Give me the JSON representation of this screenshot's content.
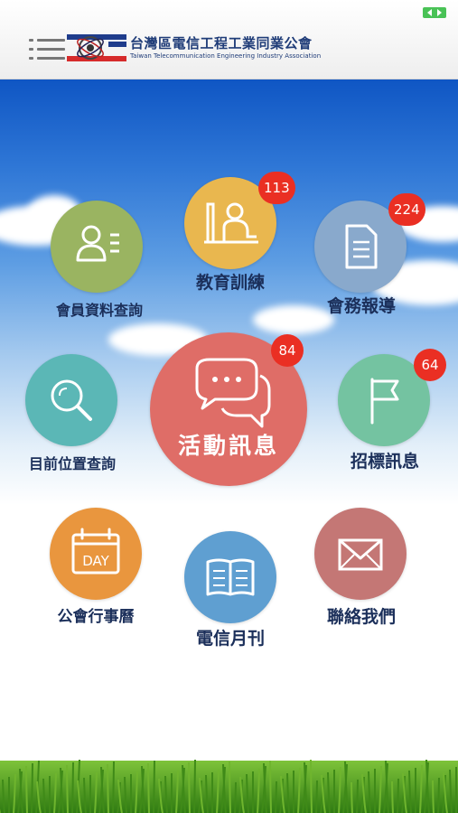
{
  "header": {
    "org_name": "台灣區電信工程工業同業公會",
    "org_name_en": "Taiwan Telecommunication Engineering Industry Association"
  },
  "icons": {
    "menu": "hamburger-menu-icon",
    "status": "battery-icon"
  },
  "colors": {
    "green": "#9ab461",
    "yellow": "#e9b74f",
    "blue_gray": "#89a9cc",
    "teal": "#5bb7b6",
    "red": "#df6d67",
    "mint": "#74c3a1",
    "orange": "#e9963e",
    "blue": "#5f9fd1",
    "rose": "#c47775",
    "badge": "#ea2f23"
  },
  "menu": {
    "member": {
      "label": "會員資料查詢"
    },
    "education": {
      "label": "教育訓練",
      "badge": "113"
    },
    "affairs": {
      "label": "會務報導",
      "badge": "224"
    },
    "location": {
      "label": "目前位置查詢"
    },
    "activity": {
      "label": "活動訊息",
      "badge": "84"
    },
    "tender": {
      "label": "招標訊息",
      "badge": "64"
    },
    "calendar": {
      "label": "公會行事曆",
      "icon_text": "DAY"
    },
    "monthly": {
      "label": "電信月刊"
    },
    "contact": {
      "label": "聯絡我們"
    }
  }
}
